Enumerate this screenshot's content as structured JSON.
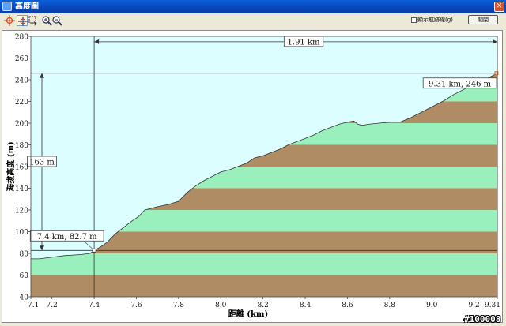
{
  "window": {
    "title": "高度圖"
  },
  "toolbar": {
    "tools": [
      "crosshair-icon",
      "pan-icon",
      "select-icon",
      "zoom-in-icon",
      "zoom-out-icon"
    ],
    "checkbox_label": "顯示航跡線(g)",
    "checkbox_checked": false,
    "close_label": "關閉"
  },
  "watermark": "#100008",
  "colors": {
    "background": "#dcfeff",
    "band_brown": "#b08c64",
    "band_green": "#9af0bd",
    "measure_line": "#333333"
  },
  "chart_data": {
    "type": "area",
    "xlabel": "距離 (km)",
    "ylabel": "海拔高度 (m)",
    "xlim": [
      7.1,
      9.31
    ],
    "ylim": [
      40,
      280
    ],
    "x_ticks": [
      7.1,
      7.2,
      7.4,
      7.6,
      7.8,
      8.0,
      8.2,
      8.4,
      8.6,
      8.8,
      9.0,
      9.2,
      9.31
    ],
    "x_tick_labels": [
      "7.1",
      "7.2",
      "7.4",
      "7.6",
      "7.8",
      "8.0",
      "8.2",
      "8.4",
      "8.6",
      "8.8",
      "9.0",
      "9.2",
      "9.31"
    ],
    "y_ticks": [
      40,
      60,
      80,
      100,
      120,
      140,
      160,
      180,
      200,
      220,
      240,
      260,
      280
    ],
    "y_tick_labels": [
      "40",
      "60",
      "80",
      "100",
      "120",
      "140",
      "160",
      "180",
      "200",
      "220",
      "240",
      "260",
      "280"
    ],
    "band_step": 20,
    "profile": {
      "x": [
        7.1,
        7.14,
        7.18,
        7.22,
        7.26,
        7.3,
        7.34,
        7.38,
        7.4,
        7.43,
        7.46,
        7.5,
        7.54,
        7.58,
        7.61,
        7.64,
        7.66,
        7.7,
        7.75,
        7.8,
        7.84,
        7.88,
        7.92,
        7.96,
        8.0,
        8.04,
        8.08,
        8.12,
        8.16,
        8.2,
        8.24,
        8.28,
        8.32,
        8.36,
        8.4,
        8.44,
        8.48,
        8.52,
        8.56,
        8.6,
        8.63,
        8.65,
        8.67,
        8.7,
        8.75,
        8.8,
        8.85,
        8.9,
        8.94,
        8.98,
        9.02,
        9.06,
        9.1,
        9.14,
        9.18,
        9.22,
        9.26,
        9.29,
        9.31
      ],
      "y": [
        75,
        75,
        76,
        77,
        78,
        78.5,
        79,
        80,
        82.7,
        86,
        90,
        98,
        104,
        110,
        114,
        120,
        121,
        123,
        125,
        128,
        136,
        142,
        147,
        151,
        155,
        157,
        160,
        163,
        168,
        170,
        173,
        176,
        180,
        183,
        186,
        189,
        193,
        196,
        199,
        201,
        202,
        199,
        198,
        199,
        200,
        201,
        201,
        205,
        209,
        213,
        217,
        221,
        226,
        230,
        234,
        237,
        241,
        244,
        246
      ]
    },
    "markers": [
      {
        "x": 7.4,
        "y": 82.7,
        "label": "7.4 km, 82.7 m"
      },
      {
        "x": 9.31,
        "y": 246,
        "label": "9.31 km, 246 m"
      }
    ],
    "measurements": {
      "horizontal_label": "1.91 km",
      "vertical_label": "163 m"
    }
  }
}
